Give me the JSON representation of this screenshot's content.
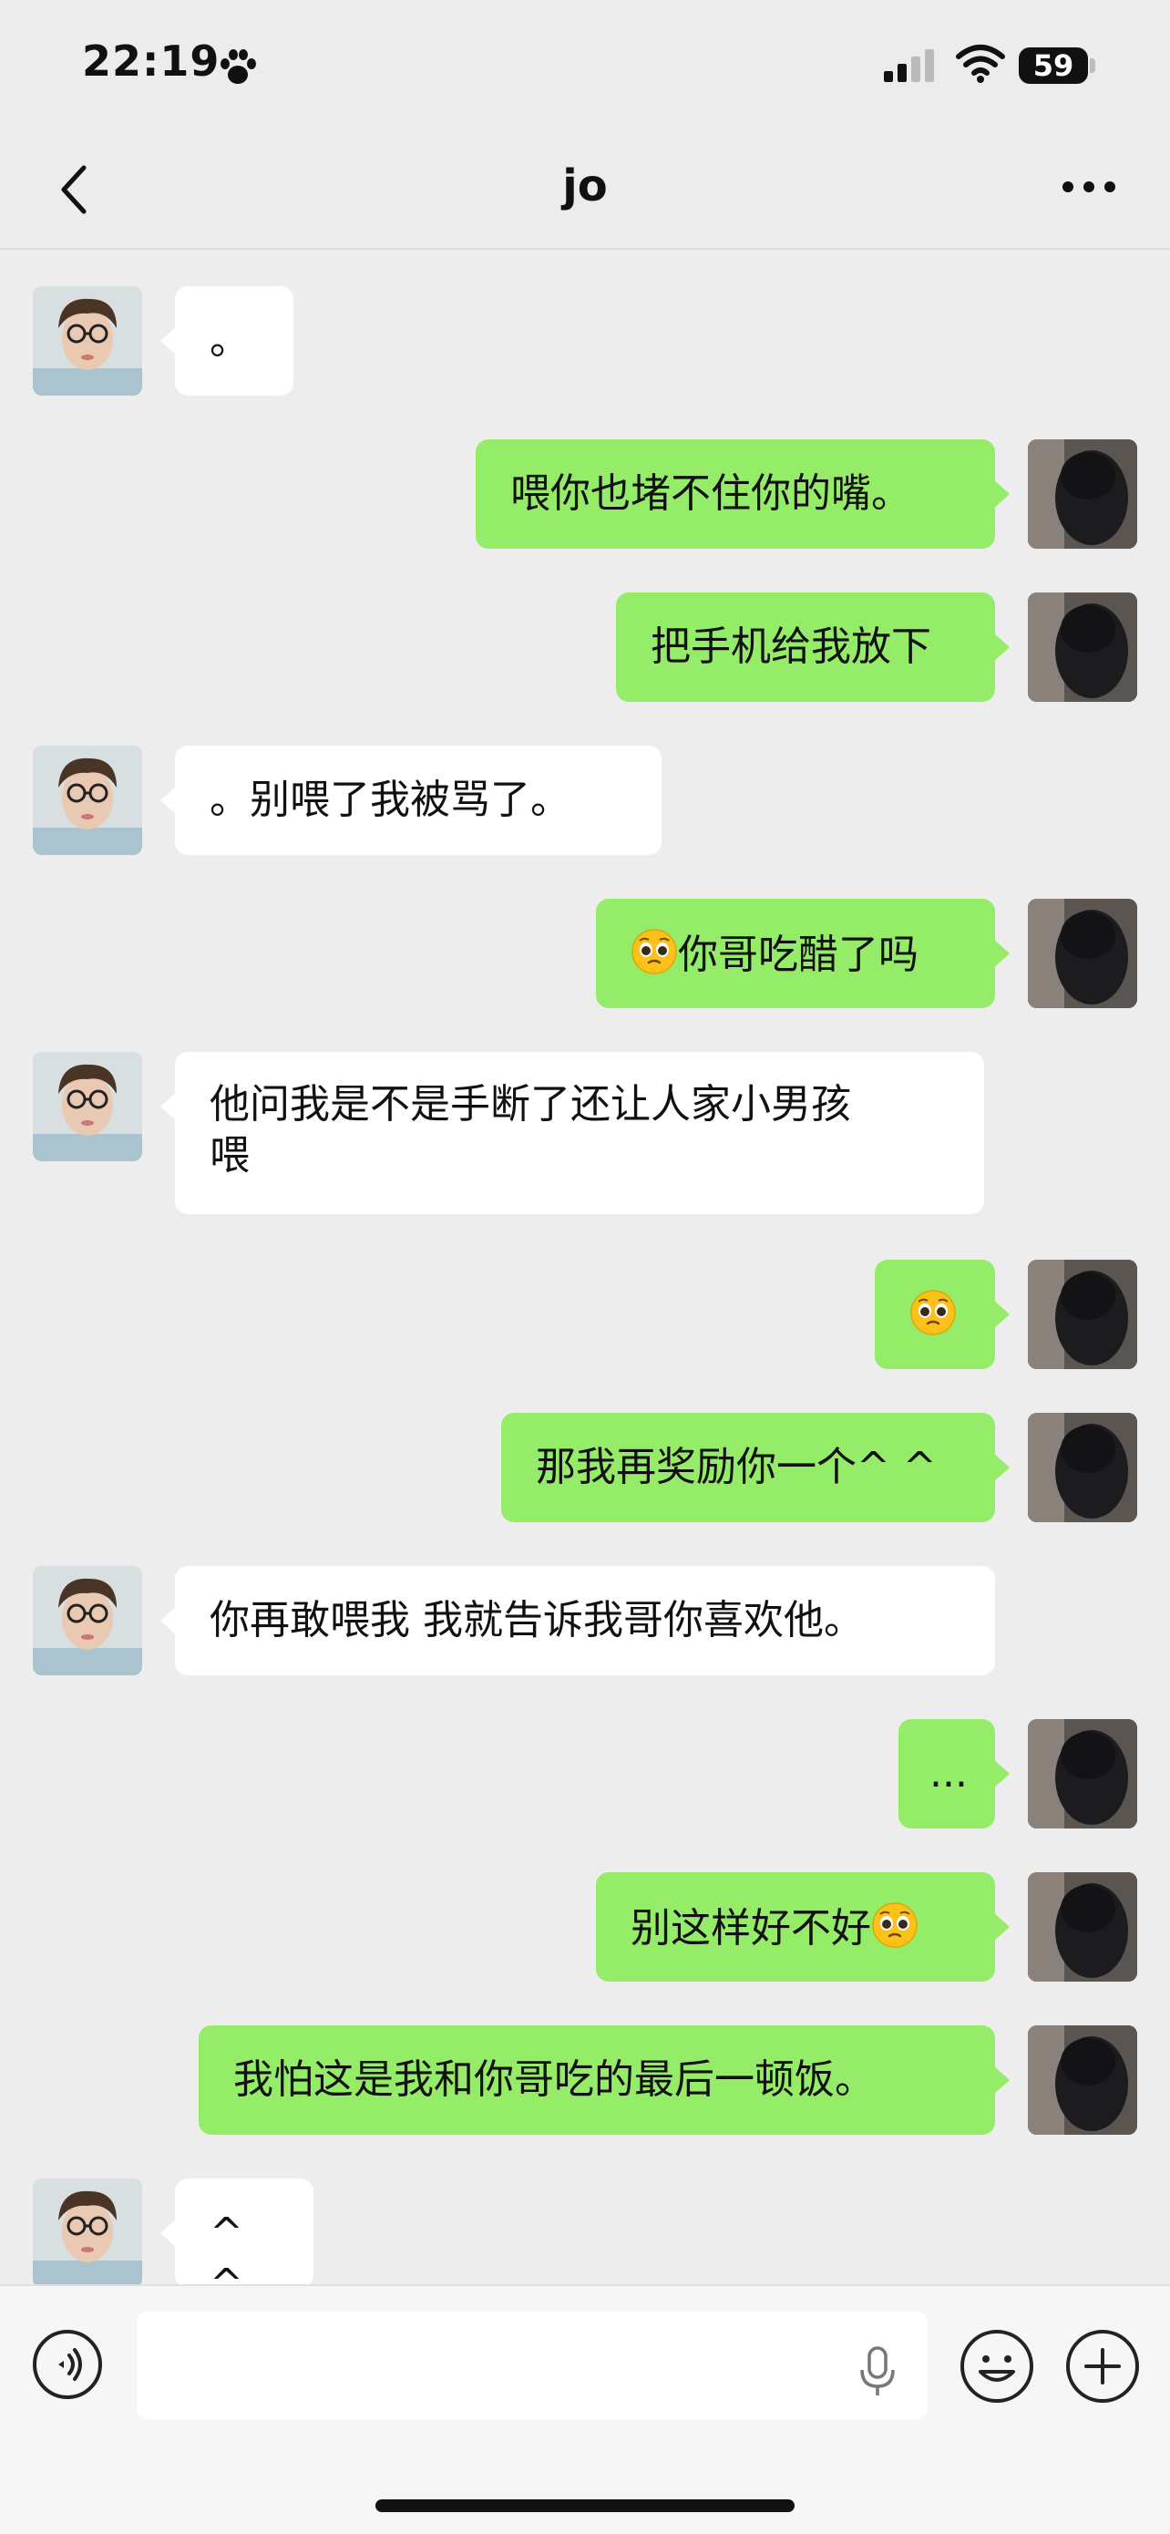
{
  "status_bar": {
    "time": "22:19",
    "battery": "59"
  },
  "header": {
    "title": "jo"
  },
  "messages": [
    {
      "from": "friend",
      "text": "。"
    },
    {
      "from": "me",
      "text": "喂你也堵不住你的嘴。"
    },
    {
      "from": "me",
      "text": "把手机给我放下"
    },
    {
      "from": "friend",
      "text": "。别喂了我被骂了。"
    },
    {
      "from": "me",
      "text": "你哥吃醋了吗",
      "emoji": "pleading-face"
    },
    {
      "from": "friend",
      "text_line1": "他问我是不是手断了还让人家小男孩",
      "text_line2": "喂"
    },
    {
      "from": "me",
      "emoji": "pleading-face"
    },
    {
      "from": "me",
      "text": "那我再奖励你一个^ ^"
    },
    {
      "from": "friend",
      "text": "你再敢喂我 我就告诉我哥你喜欢他。"
    },
    {
      "from": "me",
      "text": "..."
    },
    {
      "from": "me",
      "text": "别这样好不好",
      "emoji": "pleading-face"
    },
    {
      "from": "me",
      "text": "我怕这是我和你哥吃的最后一顿饭。"
    },
    {
      "from": "friend",
      "text": "^ ^"
    }
  ],
  "colors": {
    "my_bubble": "#95ec69",
    "friend_bubble": "#ffffff",
    "background": "#ededed"
  }
}
